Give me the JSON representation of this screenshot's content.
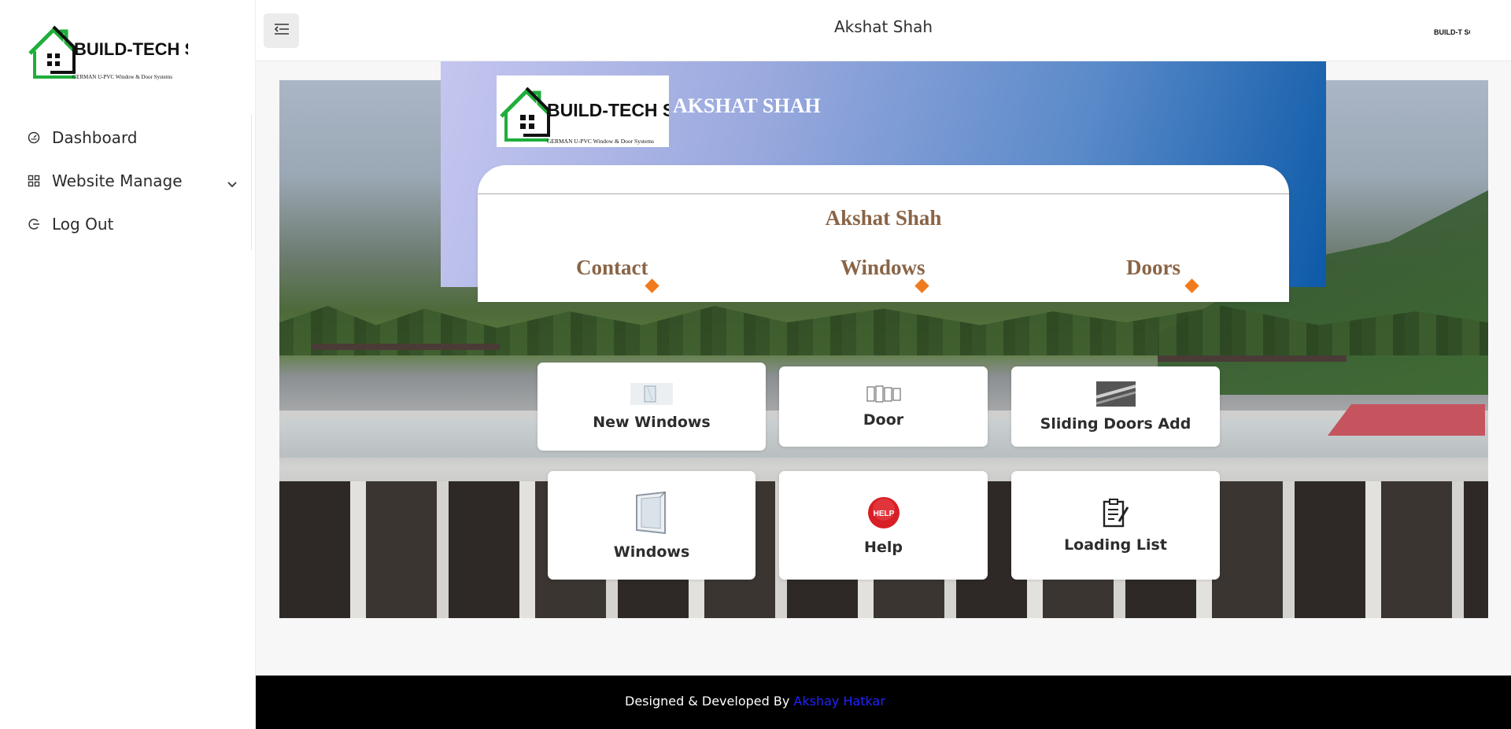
{
  "app": {
    "logo_text": "BUILD-TECH SOLUTIONS",
    "logo_tagline": "GERMAN U-PVC Window & Door Systems"
  },
  "sidebar": {
    "items": [
      {
        "label": "Dashboard",
        "icon": "gauge-icon"
      },
      {
        "label": "Website Manage",
        "icon": "grid-icon",
        "has_submenu": true
      },
      {
        "label": "Log Out",
        "icon": "logout-icon"
      }
    ]
  },
  "header": {
    "title": "Akshat Shah",
    "avatar_text": "BUILD-T SOLUT"
  },
  "profile_card": {
    "banner_name": "AKSHAT SHAH",
    "person_name": "Akshat Shah",
    "links": [
      "Contact",
      "Windows",
      "Doors"
    ],
    "accent_color": "#f07b1e",
    "name_color": "#8a6446"
  },
  "tiles": [
    {
      "label": "New Windows",
      "icon": "window-glass-icon"
    },
    {
      "label": "Door",
      "icon": "door-frames-icon"
    },
    {
      "label": "Sliding Doors Add",
      "icon": "sliding-door-photo-icon"
    },
    {
      "label": "Windows",
      "icon": "window-frame-icon"
    },
    {
      "label": "Help",
      "icon": "help-badge-icon",
      "badge_text": "HELP"
    },
    {
      "label": "Loading List",
      "icon": "clipboard-icon"
    }
  ],
  "footer": {
    "prefix": "Designed & Developed By",
    "author": "Akshay Hatkar"
  }
}
